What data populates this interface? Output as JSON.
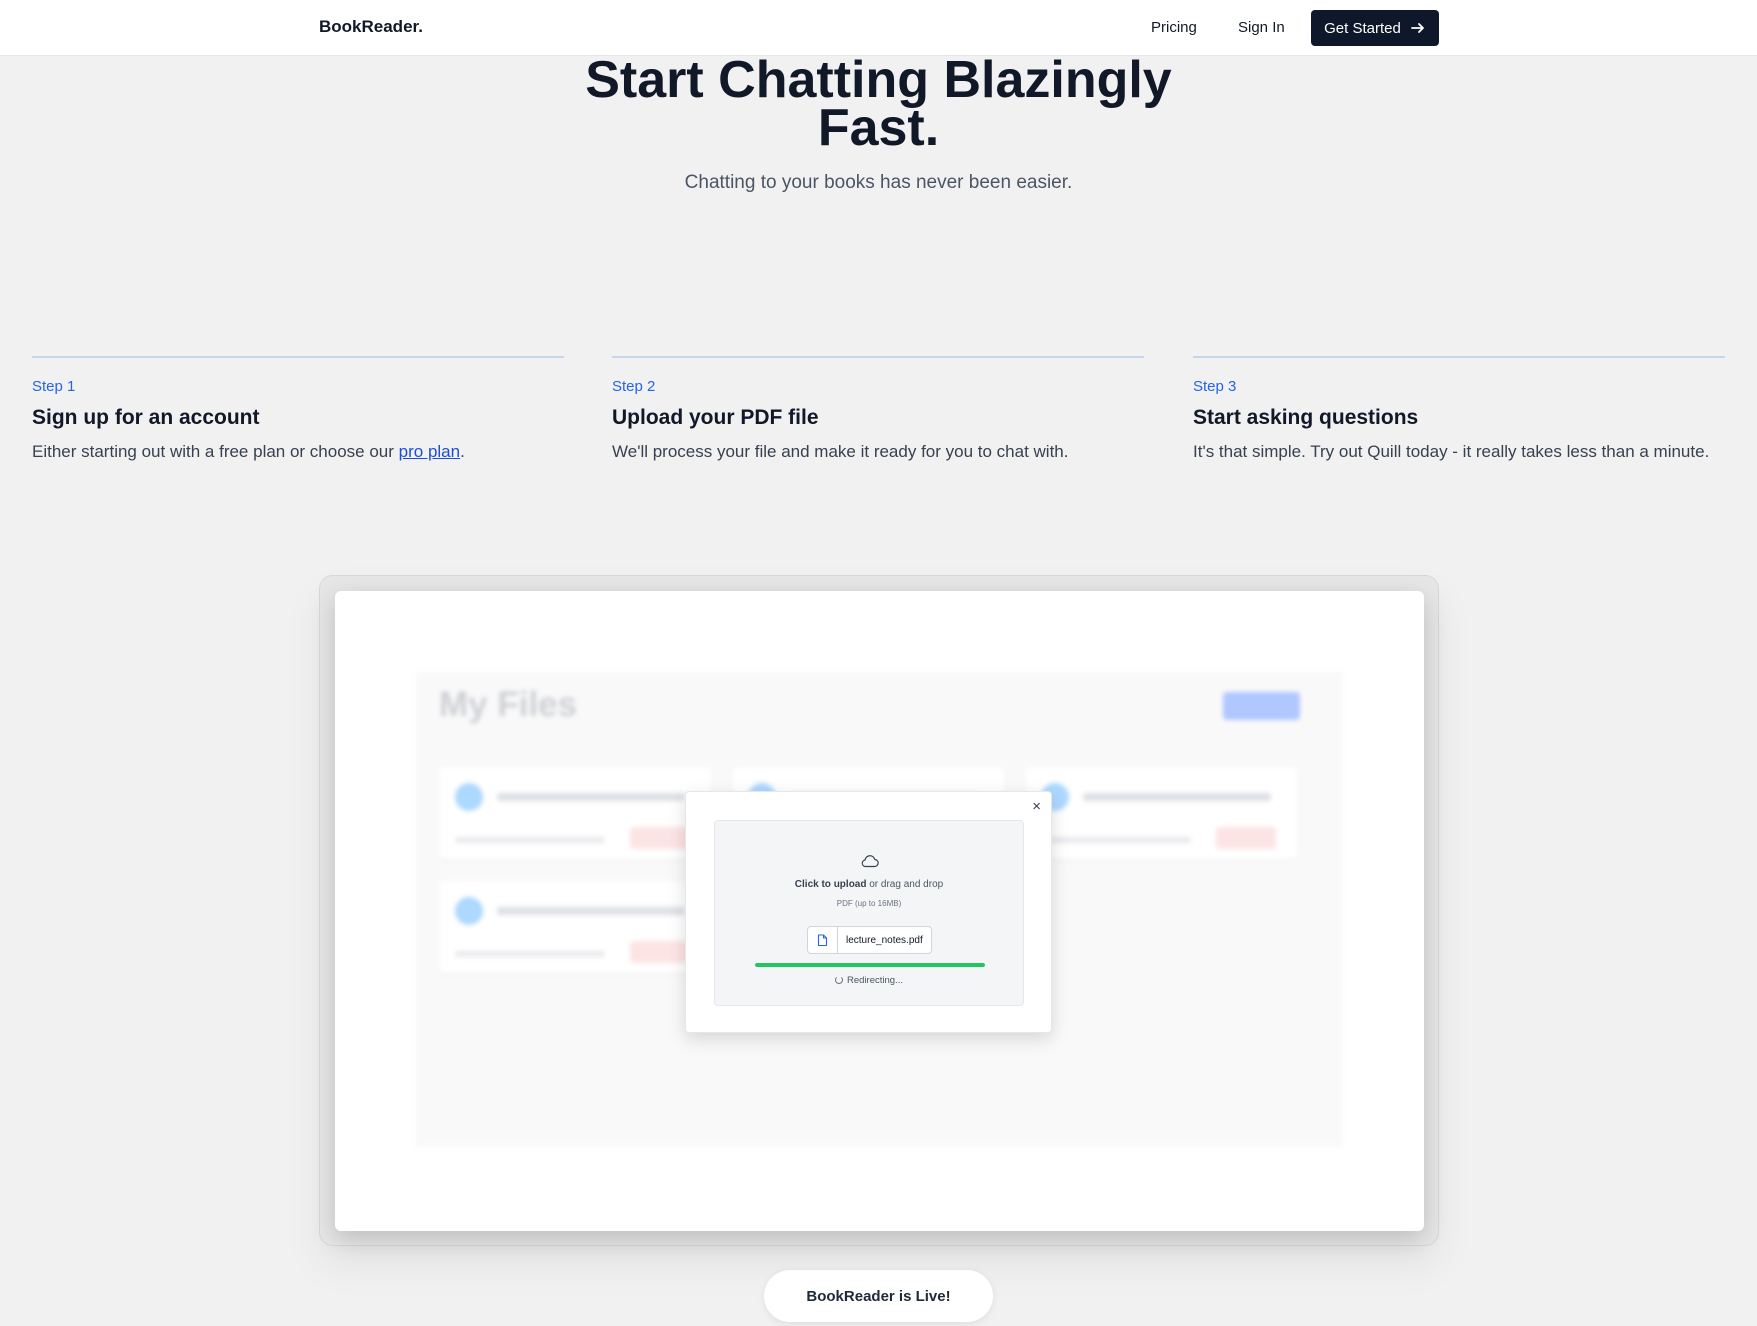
{
  "nav": {
    "brand": "BookReader.",
    "links": [
      "Pricing",
      "Sign In"
    ],
    "cta": "Get Started"
  },
  "hero": {
    "title_line1": "Start Chatting Blazingly",
    "title_line2": "Fast.",
    "subtitle": "Chatting to your books has never been easier."
  },
  "steps": [
    {
      "label": "Step 1",
      "title": "Sign up for an account",
      "desc_before": "Either starting out with a free plan or choose our ",
      "desc_link": "pro plan",
      "desc_after": "."
    },
    {
      "label": "Step 2",
      "title": "Upload your PDF file",
      "desc": "We'll process your file and make it ready for you to chat with."
    },
    {
      "label": "Step 3",
      "title": "Start asking questions",
      "desc": "It's that simple. Try out Quill today - it really takes less than a minute."
    }
  ],
  "preview": {
    "background_title": "My Files",
    "upload_modal": {
      "close": "×",
      "click_text": "Click to upload",
      "rest_text": " or drag and drop",
      "hint": "PDF (up to 16MB)",
      "file_name": "lecture_notes.pdf",
      "progress_percent": 100,
      "status": "Redirecting..."
    }
  },
  "footer_pill": "BookReader is Live!",
  "colors": {
    "primary_dark": "#0f172a",
    "accent_blue": "#2563eb",
    "progress_green": "#22c55e"
  }
}
